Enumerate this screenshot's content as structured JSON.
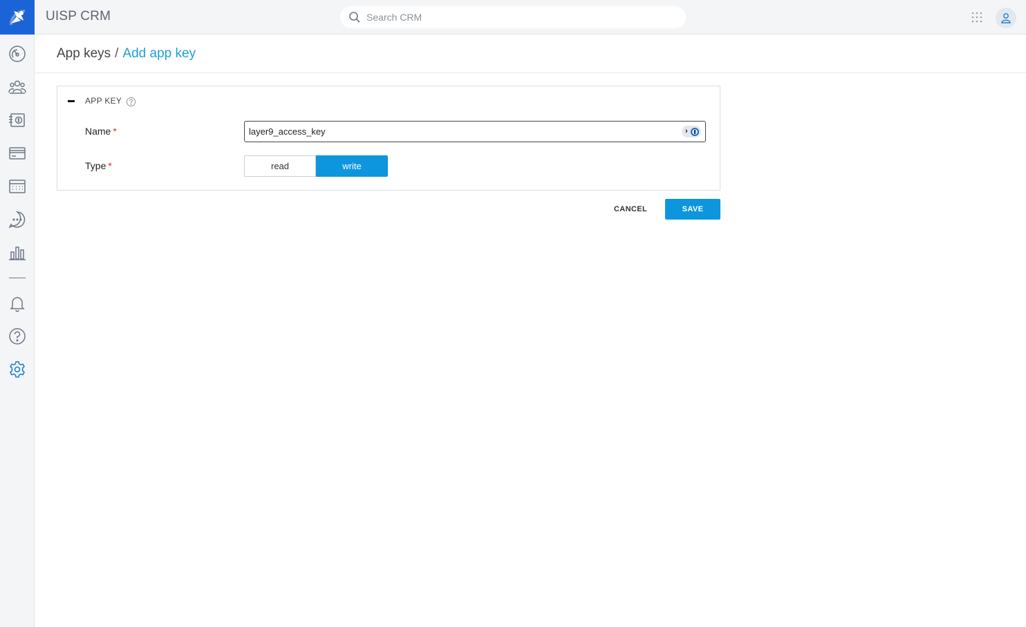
{
  "app": {
    "title": "UISP CRM"
  },
  "search": {
    "placeholder": "Search CRM"
  },
  "sidebar": {
    "items": [
      {
        "name": "dashboard",
        "icon": "gauge-icon"
      },
      {
        "name": "clients",
        "icon": "users-icon"
      },
      {
        "name": "billing",
        "icon": "invoice-icon"
      },
      {
        "name": "payments",
        "icon": "card-icon"
      },
      {
        "name": "scheduling",
        "icon": "calendar-icon"
      },
      {
        "name": "tickets",
        "icon": "chat-icon"
      },
      {
        "name": "reports",
        "icon": "bar-chart-icon"
      },
      {
        "name": "notifications",
        "icon": "bell-icon"
      },
      {
        "name": "help",
        "icon": "help-icon"
      },
      {
        "name": "settings",
        "icon": "gear-icon",
        "active": true
      }
    ]
  },
  "breadcrumb": {
    "parent": "App keys",
    "separator": "/",
    "current": "Add app key"
  },
  "panel": {
    "title": "APP KEY",
    "fields": {
      "name": {
        "label": "Name",
        "required_mark": "*",
        "value": "layer9_access_key"
      },
      "type": {
        "label": "Type",
        "required_mark": "*",
        "options": [
          "read",
          "write"
        ],
        "selected": "write"
      }
    }
  },
  "actions": {
    "cancel_label": "CANCEL",
    "save_label": "SAVE"
  },
  "colors": {
    "accent": "#0d96dd",
    "brand": "#1b64d8",
    "link": "#1e9fd8",
    "required": "#e0262f"
  }
}
